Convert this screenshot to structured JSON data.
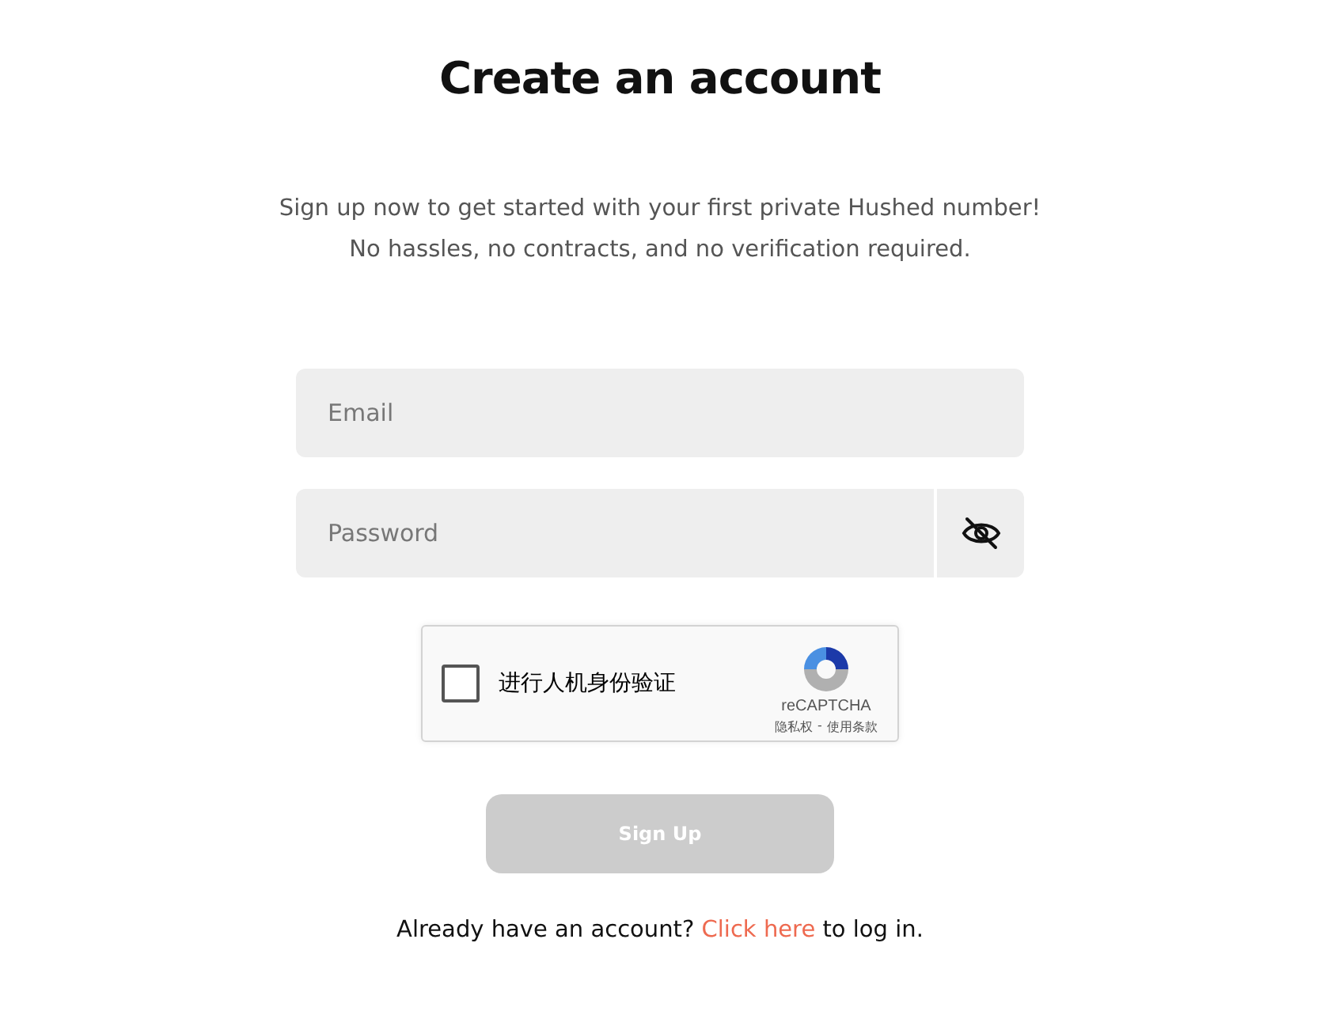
{
  "title": "Create an account",
  "intro": [
    "Sign up now to get started with your first private Hushed number!",
    "No hassles, no contracts, and no verification required."
  ],
  "fields": [
    {
      "kind": "email",
      "placeholder": "Email"
    },
    {
      "kind": "password",
      "placeholder": "Password"
    }
  ],
  "captcha": {
    "label": "进行人机身份验证",
    "checked": false,
    "brand": "reCAPTCHA",
    "privacy": "隐私权",
    "separator": "-",
    "terms": "使用条款"
  },
  "submit": {
    "label": "Sign Up",
    "disabled": true
  },
  "footer": {
    "before": "Already have an account?",
    "link": "Click here",
    "after": "to log in."
  }
}
